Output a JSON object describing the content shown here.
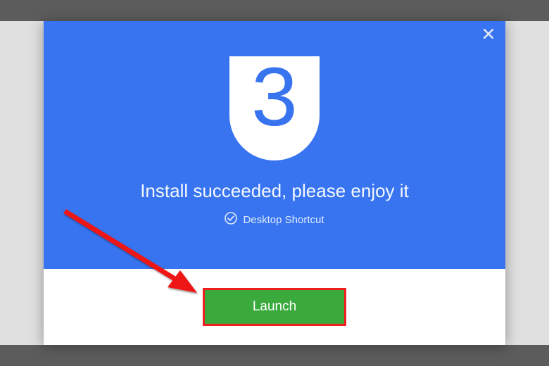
{
  "dialog": {
    "close_label": "Close",
    "logo_digit": "3",
    "headline": "Install succeeded, please enjoy it",
    "shortcut_label": "Desktop Shortcut",
    "launch_label": "Launch"
  },
  "colors": {
    "hero_bg": "#3874ef",
    "launch_bg": "#3aaa3d",
    "highlight_outline": "#ef1f1f"
  }
}
